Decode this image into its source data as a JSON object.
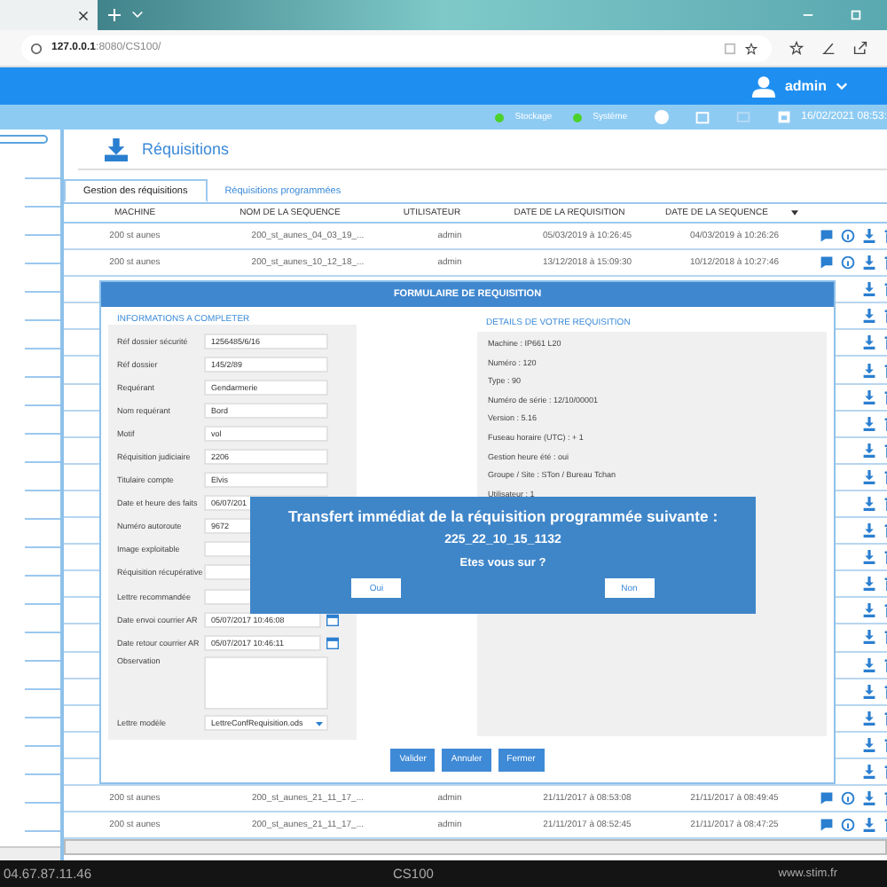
{
  "browser": {
    "url_host": "127.0.0.1",
    "url_path": ":8080/CS100/"
  },
  "header": {
    "user": "admin"
  },
  "status_bar": {
    "indicators": [
      {
        "label": "Stockage",
        "color": "#4cd12a"
      },
      {
        "label": "Système",
        "color": "#4cd12a"
      }
    ],
    "datetime": "16/02/2021 08:53:"
  },
  "section_title": "Réquisitions",
  "tabs": [
    {
      "label": "Gestion des réquisitions",
      "selected": true
    },
    {
      "label": "Réquisitions programmées",
      "selected": false
    }
  ],
  "table": {
    "columns": [
      "MACHINE",
      "NOM DE LA SEQUENCE",
      "UTILISATEUR",
      "DATE DE LA REQUISITION",
      "DATE DE LA SEQUENCE"
    ],
    "rows": [
      {
        "kind": "full",
        "cells": [
          "200 st aunes",
          "200_st_aunes_04_03_19_...",
          "admin",
          "05/03/2019 à 10:26:45",
          "04/03/2019 à 10:26:26"
        ]
      },
      {
        "kind": "full",
        "cells": [
          "200 st aunes",
          "200_st_aunes_10_12_18_...",
          "admin",
          "13/12/2018 à 15:09:30",
          "10/12/2018 à 10:27:46"
        ]
      },
      {
        "kind": "covered"
      },
      {
        "kind": "covered"
      },
      {
        "kind": "covered"
      },
      {
        "kind": "covered"
      },
      {
        "kind": "covered"
      },
      {
        "kind": "covered"
      },
      {
        "kind": "covered"
      },
      {
        "kind": "covered"
      },
      {
        "kind": "covered"
      },
      {
        "kind": "covered"
      },
      {
        "kind": "covered"
      },
      {
        "kind": "covered"
      },
      {
        "kind": "covered"
      },
      {
        "kind": "covered"
      },
      {
        "kind": "covered"
      },
      {
        "kind": "covered"
      },
      {
        "kind": "covered"
      },
      {
        "kind": "covered"
      },
      {
        "kind": "covered"
      },
      {
        "kind": "full",
        "cells": [
          "200 st aunes",
          "200_st_aunes_21_11_17_...",
          "admin",
          "21/11/2017 à 08:53:08",
          "21/11/2017 à 08:49:45"
        ]
      },
      {
        "kind": "full",
        "cells": [
          "200 st aunes",
          "200_st_aunes_21_11_17_...",
          "admin",
          "21/11/2017 à 08:52:45",
          "21/11/2017 à 08:47:25"
        ]
      }
    ]
  },
  "form": {
    "title": "FORMULAIRE DE REQUISITION",
    "left_title": "INFORMATIONS A COMPLETER",
    "fields": [
      {
        "label": "Réf dossier sécurité",
        "kind": "text",
        "value": "1256485/6/16"
      },
      {
        "label": "Réf dossier",
        "kind": "text",
        "value": "145/2/89"
      },
      {
        "label": "Requérant",
        "kind": "text",
        "value": "Gendarmerie"
      },
      {
        "label": "Nom requérant",
        "kind": "text",
        "value": "Bord"
      },
      {
        "label": "Motif",
        "kind": "text",
        "value": "vol"
      },
      {
        "label": "Réquisition judiciaire",
        "kind": "text",
        "value": "2206"
      },
      {
        "label": "Titulaire compte",
        "kind": "text",
        "value": "Elvis"
      },
      {
        "label": "Date et heure des faits",
        "kind": "text",
        "value": "06/07/201"
      },
      {
        "label": "Numéro autoroute",
        "kind": "text",
        "value": "9672"
      },
      {
        "label": "Image exploitable",
        "kind": "text"
      },
      {
        "label": "Réquisition récupérative",
        "kind": "text"
      },
      {
        "label": "Lettre recommandée",
        "kind": "text"
      },
      {
        "label": "Date envoi courrier AR",
        "kind": "date",
        "value": "05/07/2017 10:46:08"
      },
      {
        "label": "Date retour courrier AR",
        "kind": "date",
        "value": "05/07/2017 10:46:11"
      },
      {
        "label": "Observation",
        "kind": "textarea"
      },
      {
        "label": "Lettre modèle",
        "kind": "select",
        "value": "LettreConfRequisition.ods"
      }
    ],
    "right_title": "DETAILS DE VOTRE REQUISITION",
    "details": [
      "Machine : IP661 L20",
      "Numéro : 120",
      "Type : 90",
      "Numéro de série : 12/10/00001",
      "Version : 5.16",
      "Fuseau horaire (UTC) : + 1",
      "Gestion heure été : oui",
      "Groupe / Site : STon / Bureau Tchan",
      "Utilisateur : 1"
    ],
    "buttons": [
      "Valider",
      "Annuler",
      "Fermer"
    ]
  },
  "dialog": {
    "message": "Transfert immédiat de la réquisition programmée suivante :",
    "code": "225_22_10_15_1132",
    "question": "Etes vous sur ?",
    "buttons": [
      "Oui",
      "Non"
    ]
  },
  "footer": {
    "phone": "04.67.87.11.46",
    "product": "CS100",
    "website": "www.stim.fr"
  }
}
